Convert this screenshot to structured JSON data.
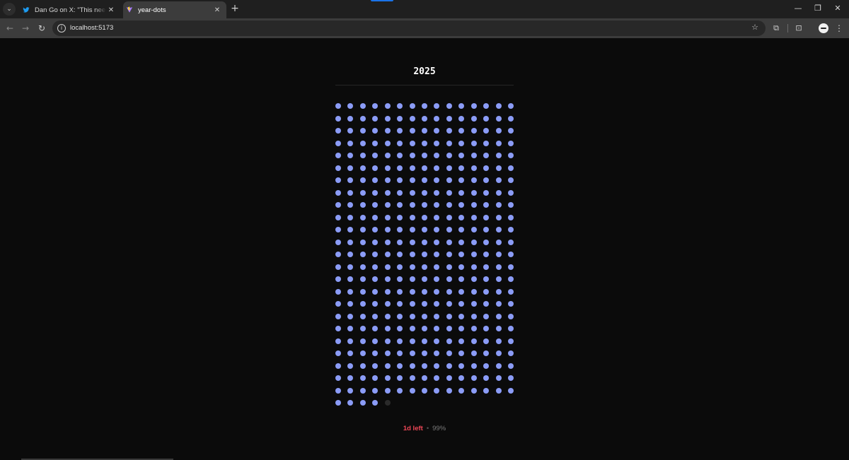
{
  "browser": {
    "tabs": [
      {
        "title": "Dan Go on X: \"This needs to be",
        "favicon": "twitter-bird-icon",
        "active": false
      },
      {
        "title": "year-dots",
        "favicon": "vite-icon",
        "active": true
      }
    ],
    "url": "localhost:5173",
    "icons": [
      "tab-search-icon",
      "close-icon",
      "new-tab-icon",
      "minimize-icon",
      "restore-icon",
      "back-icon",
      "forward-icon",
      "reload-icon",
      "site-info-icon",
      "bookmark-star-icon",
      "extensions-icon",
      "media-icon",
      "profile-avatar-icon",
      "menu-icon"
    ]
  },
  "page": {
    "year": "2025",
    "days_total": 365,
    "days_elapsed": 364,
    "columns": 15,
    "status": {
      "left_text": "1d left",
      "separator": "•",
      "percent_text": "99%"
    }
  },
  "colors": {
    "background": "#0b0b0b",
    "dot_elapsed": "#8b9cf7",
    "dot_remaining": "#2a2a2a",
    "days_left": "#f04757",
    "percent": "#7c7c7c"
  }
}
